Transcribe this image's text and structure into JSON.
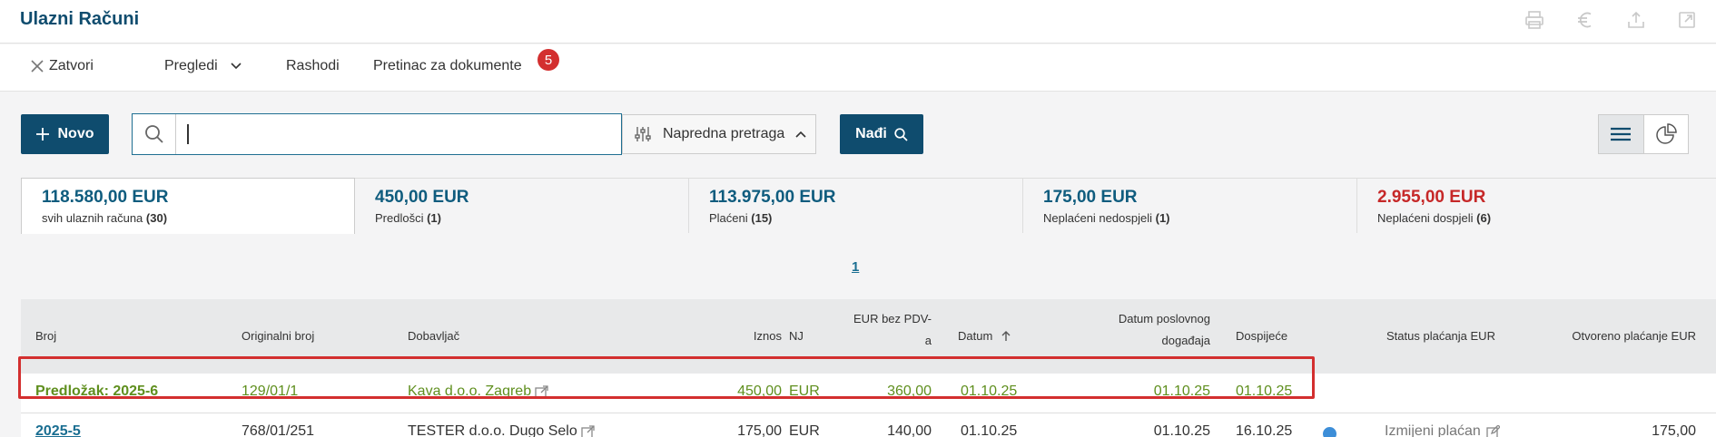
{
  "header": {
    "title": "Ulazni Računi",
    "icons": [
      "print-icon",
      "euro-icon",
      "upload-icon",
      "external-window-icon"
    ]
  },
  "menu": {
    "close_label": "Zatvori",
    "views_label": "Pregledi",
    "expenses_label": "Rashodi",
    "document_box_label": "Pretinac za dokumente",
    "document_box_count": "5"
  },
  "toolbar": {
    "new_label": "Novo",
    "search_value": "",
    "advanced_search_label": "Napredna pretraga",
    "find_label": "Nađi"
  },
  "summary": [
    {
      "amount": "118.580,00 EUR",
      "label": "svih ulaznih računa",
      "count": "(30)"
    },
    {
      "amount": "450,00 EUR",
      "label": "Predlošci",
      "count": "(1)"
    },
    {
      "amount": "113.975,00 EUR",
      "label": "Plaćeni",
      "count": "(15)"
    },
    {
      "amount": "175,00 EUR",
      "label": "Neplaćeni nedospjeli",
      "count": "(1)"
    },
    {
      "amount": "2.955,00 EUR",
      "label": "Neplaćeni dospjeli",
      "count": "(6)"
    }
  ],
  "pagination": {
    "current": "1"
  },
  "table": {
    "columns": {
      "broj": "Broj",
      "originalni": "Originalni broj",
      "dobavljac": "Dobavljač",
      "iznos": "Iznos",
      "nj": "NJ",
      "eur_bez_pdv_1": "EUR bez PDV-",
      "eur_bez_pdv_2": "a",
      "datum": "Datum",
      "datum_poslovnog_1": "Datum poslovnog",
      "datum_poslovnog_2": "događaja",
      "dospijece": "Dospijeće",
      "status": "Status plaćanja EUR",
      "otvoreno": "Otvoreno plaćanje EUR"
    },
    "rows": [
      {
        "broj": "Predložak: 2025-6",
        "originalni": "129/01/1",
        "dobavljac": "Kava d.o.o. Zagreb",
        "iznos": "450,00",
        "nj": "EUR",
        "bez_pdv": "360,00",
        "datum": "01.10.25",
        "datum_poslovnog": "01.10.25",
        "dospijece": "01.10.25",
        "status": "",
        "otvoreno": ""
      },
      {
        "broj": "2025-5",
        "originalni": "768/01/251",
        "dobavljac": "TESTER d.o.o. Dugo Selo",
        "iznos": "175,00",
        "nj": "EUR",
        "bez_pdv": "140,00",
        "datum": "01.10.25",
        "datum_poslovnog": "01.10.25",
        "dospijece": "16.10.25",
        "status": "Izmijeni plaćan",
        "otvoreno": "175,00"
      }
    ]
  },
  "colors": {
    "brand": "#0f4c6e",
    "template_green": "#5f8f1e",
    "overdue_red": "#c62828",
    "highlight": "#d32f2f"
  }
}
